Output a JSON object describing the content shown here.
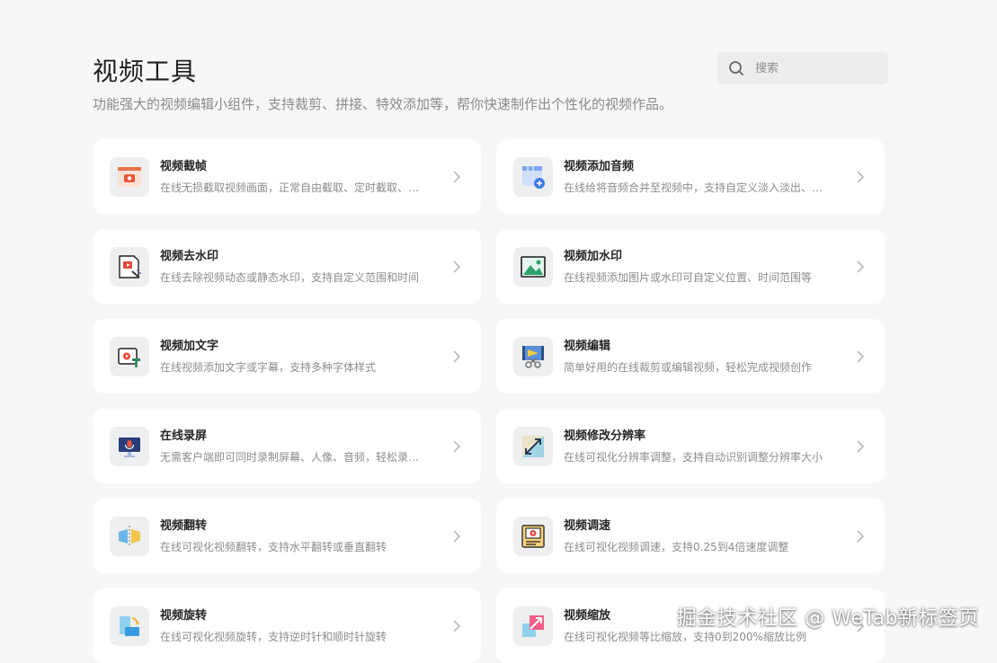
{
  "header": {
    "title": "视频工具",
    "subtitle": "功能强大的视频编辑小组件，支持裁剪、拼接、特效添加等，帮你快速制作出个性化的视频作品。"
  },
  "search": {
    "placeholder": "搜索"
  },
  "tools": [
    {
      "name": "视频截帧",
      "desc": "在线无损截取视频画面，正常自由截取、定时截取、…",
      "icon": "video-frame-capture-icon"
    },
    {
      "name": "视频添加音频",
      "desc": "在线给将音频合并至视频中，支持自定义淡入淡出、…",
      "icon": "video-add-audio-icon"
    },
    {
      "name": "视频去水印",
      "desc": "在线去除视频动态或静态水印，支持自定义范围和时间",
      "icon": "video-remove-watermark-icon"
    },
    {
      "name": "视频加水印",
      "desc": "在线视频添加图片或水印可自定义位置、时间范围等",
      "icon": "video-add-watermark-icon"
    },
    {
      "name": "视频加文字",
      "desc": "在线视频添加文字或字幕，支持多种字体样式",
      "icon": "video-add-text-icon"
    },
    {
      "name": "视频编辑",
      "desc": "简单好用的在线裁剪或编辑视频，轻松完成视频创作",
      "icon": "video-edit-icon"
    },
    {
      "name": "在线录屏",
      "desc": "无需客户端即可同时录制屏幕、人像、音频，轻松录…",
      "icon": "screen-record-icon"
    },
    {
      "name": "视频修改分辨率",
      "desc": "在线可视化分辨率调整，支持自动识别调整分辨率大小",
      "icon": "video-resolution-icon"
    },
    {
      "name": "视频翻转",
      "desc": "在线可视化视频翻转，支持水平翻转或垂直翻转",
      "icon": "video-flip-icon"
    },
    {
      "name": "视频调速",
      "desc": "在线可视化视频调速，支持0.25到4倍速度调整",
      "icon": "video-speed-icon"
    },
    {
      "name": "视频旋转",
      "desc": "在线可视化视频旋转，支持逆时针和顺时针旋转",
      "icon": "video-rotate-icon"
    },
    {
      "name": "视频缩放",
      "desc": "在线可视化视频等比缩放，支持0到200%缩放比例",
      "icon": "video-scale-icon"
    }
  ],
  "watermark": "掘金技术社区 @ WeTab新标签页"
}
